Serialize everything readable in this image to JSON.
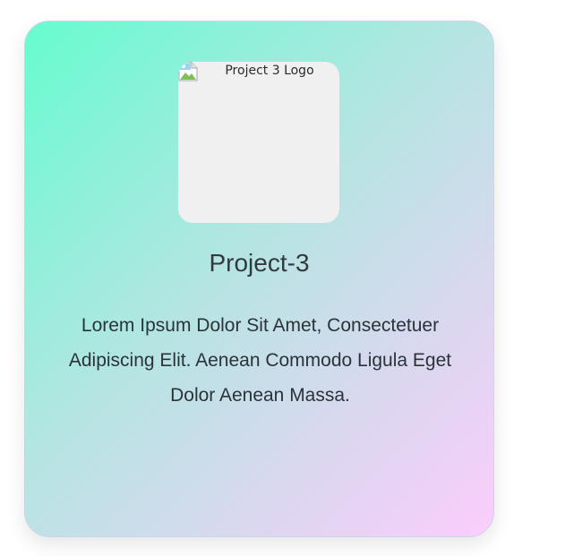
{
  "card": {
    "logo_alt": "Project 3 Logo",
    "title": "Project-3",
    "description": "Lorem Ipsum Dolor Sit Amet, Consectetuer Adipiscing Elit. Aenean Commodo Ligula Eget Dolor Aenean Massa.",
    "logo_icon": "broken-image-icon"
  }
}
